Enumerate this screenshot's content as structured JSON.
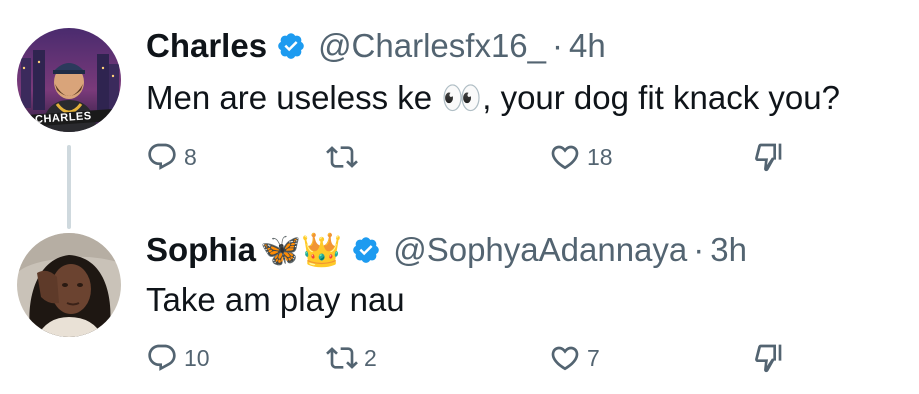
{
  "tweets": [
    {
      "name": "Charles",
      "name_emojis": "",
      "handle": "@Charlesfx16_",
      "separator": "·",
      "time": "4h",
      "text": "Men are useless ke",
      "text_emoji": "👀",
      "text_after": ", your dog fit knack you?",
      "avatar_label": "CHARLES",
      "replies": "8",
      "retweets": "",
      "likes": "18"
    },
    {
      "name": "Sophia",
      "name_emojis": "🦋👑",
      "handle": "@SophyaAdannaya",
      "separator": "·",
      "time": "3h",
      "text": "Take am play nau",
      "text_emoji": "",
      "text_after": "",
      "replies": "10",
      "retweets": "2",
      "likes": "7"
    }
  ],
  "colors": {
    "verified": "#1d9bf0",
    "secondary_text": "#536471",
    "primary_text": "#0f1419",
    "thread_line": "#cfd9de"
  },
  "icons": [
    "reply-icon",
    "retweet-icon",
    "like-icon",
    "dislike-icon",
    "verified-badge-icon"
  ]
}
